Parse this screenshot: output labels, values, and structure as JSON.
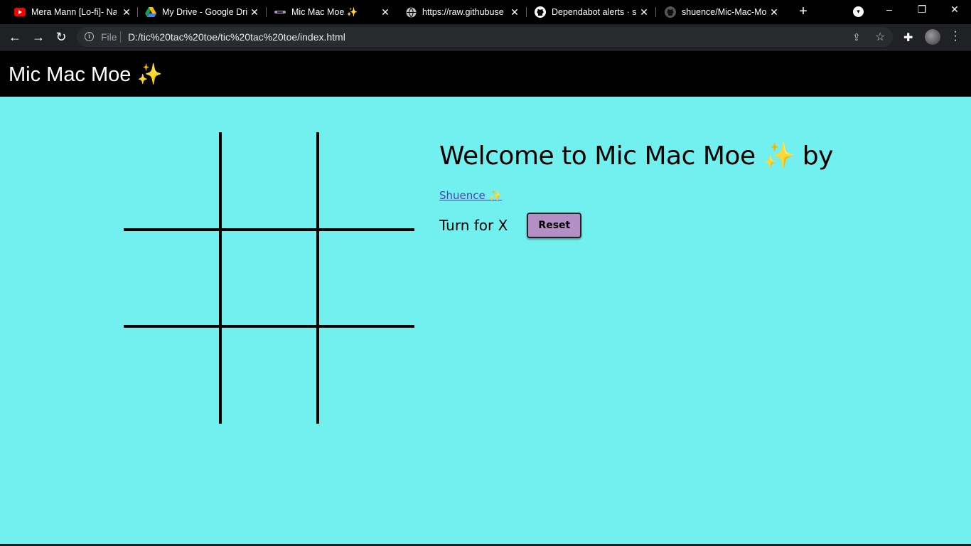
{
  "browser": {
    "tabs": [
      {
        "title": "Mera Mann [Lo-fi]- Na",
        "icon": "youtube-icon",
        "color": "#ff0000"
      },
      {
        "title": "My Drive - Google Dri",
        "icon": "google-drive-icon",
        "color": "#fbbc04"
      },
      {
        "title": "Mic Mac Moe ✨",
        "icon": "site-favicon",
        "color": "#b48fc5"
      },
      {
        "title": "https://raw.githubuse",
        "icon": "globe-icon",
        "color": "#bdc1c6"
      },
      {
        "title": "Dependabot alerts · sh",
        "icon": "github-icon",
        "color": "#ffffff"
      },
      {
        "title": "shuence/Mic-Mac-Mo",
        "icon": "github-icon",
        "color": "#555555"
      }
    ],
    "omnibox": {
      "scheme": "File",
      "url": "D:/tic%20tac%20toe/tic%20tac%20toe/index.html"
    }
  },
  "site": {
    "title": "Mic Mac Moe ✨",
    "welcome": "Welcome to Mic Mac Moe ✨ by",
    "author": "Shuence ✨",
    "turn": "Turn for X",
    "reset_label": "Reset",
    "background_color": "#72f0ef",
    "button_color": "#b48fc5"
  }
}
